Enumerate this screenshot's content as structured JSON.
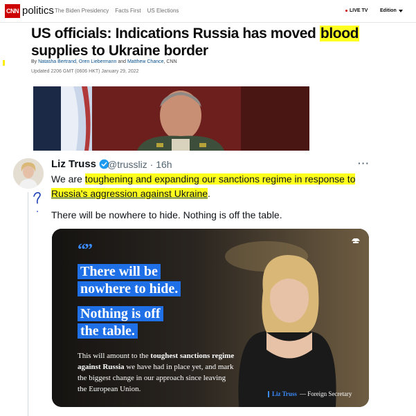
{
  "cnn": {
    "logo": "CNN",
    "section": "politics",
    "nav": [
      "The Biden Presidency",
      "Facts First",
      "US Elections"
    ],
    "live_tv": "LIVE TV",
    "edition": "Edition",
    "headline_pre": "US officials: Indications Russia has moved ",
    "headline_mark": "blood",
    "headline_post": " supplies to Ukraine border",
    "byline_by": "By",
    "author1": "Natasha Bertrand",
    "author2": "Oren Liebermann",
    "byline_and": "and",
    "author3": "Matthew Chance",
    "byline_outlet": ", CNN",
    "updated": "Updated 2206 GMT (0606 HKT) January 29, 2022"
  },
  "tweet": {
    "name": "Liz Truss",
    "handle": "@trussliz · 16h",
    "more": "···",
    "text_pre": "We are ",
    "text_mark1": "toughening and expanding our sanctions regime in response to",
    "text_mark2": "Russia's aggression against Ukraine",
    "text_end": ".",
    "text2": "There will be nowhere to hide. Nothing is off the table.",
    "annotation": "?",
    "media": {
      "quote_mark": "“”",
      "line1": "There will be",
      "line2": "nowhere to hide.",
      "line3": "Nothing is off",
      "line4": "the table.",
      "small_1": "This will amount to the ",
      "small_bold1": "toughest sanctions regime against Russia",
      "small_2": " we have had in place yet, and mark the biggest change in our approach since leaving the European Union.",
      "caption_name": "Liz Truss",
      "caption_role": "— Foreign Secretary"
    }
  },
  "colors": {
    "cnn_red": "#cc0000",
    "highlight": "#ffff22",
    "quote_blue": "#1f6fe6",
    "twitter_blue": "#1d9bf0"
  }
}
